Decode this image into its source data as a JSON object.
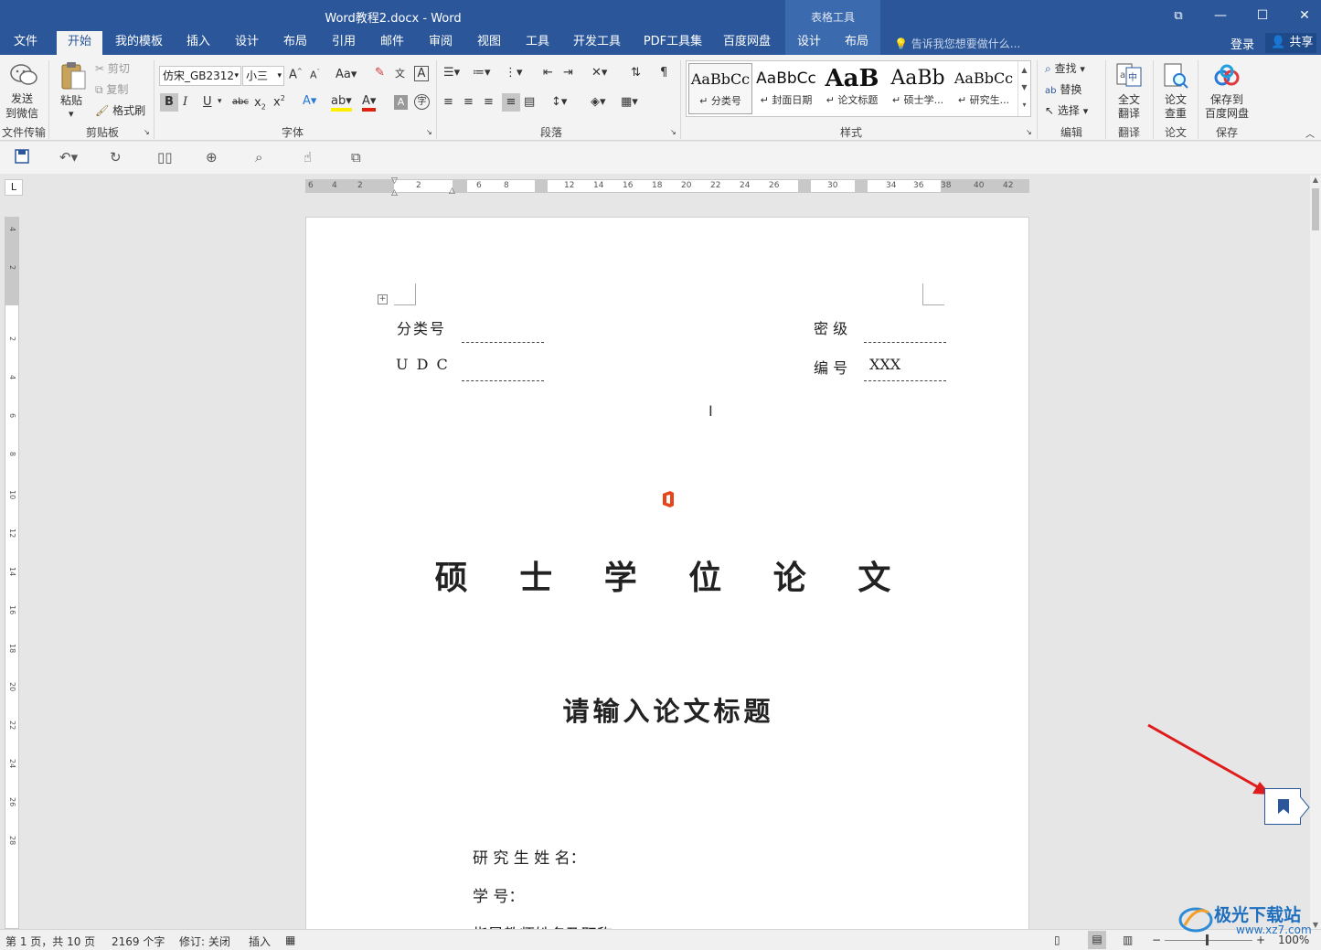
{
  "window": {
    "title": "Word教程2.docx - Word",
    "context_title": "表格工具",
    "minimize": "—",
    "maximize": "☐",
    "close": "✕",
    "restore_icon": "⧉"
  },
  "tabs": [
    {
      "label": "文件"
    },
    {
      "label": "开始"
    },
    {
      "label": "我的模板"
    },
    {
      "label": "插入"
    },
    {
      "label": "设计"
    },
    {
      "label": "布局"
    },
    {
      "label": "引用"
    },
    {
      "label": "邮件"
    },
    {
      "label": "审阅"
    },
    {
      "label": "视图"
    },
    {
      "label": "工具"
    },
    {
      "label": "开发工具"
    },
    {
      "label": "PDF工具集"
    },
    {
      "label": "百度网盘"
    },
    {
      "label": "设计"
    },
    {
      "label": "布局"
    }
  ],
  "tell_me": "告诉我您想要做什么...",
  "login": "登录",
  "share": "共享",
  "ribbon": {
    "wechat": {
      "line1": "发送",
      "line2": "到微信",
      "group": "文件传输"
    },
    "clipboard": {
      "paste": "粘贴",
      "cut": "剪切",
      "copy": "复制",
      "format_painter": "格式刷",
      "group": "剪贴板"
    },
    "font": {
      "name": "仿宋_GB2312",
      "size": "小三",
      "group": "字体"
    },
    "paragraph": {
      "group": "段落"
    },
    "styles": {
      "group": "样式",
      "items": [
        {
          "sample": "AaBbCc",
          "name": "↵ 分类号"
        },
        {
          "sample": "AaBbCc",
          "name": "↵ 封面日期"
        },
        {
          "sample": "AaB",
          "name": "↵ 论文标题"
        },
        {
          "sample": "AaBb",
          "name": "↵ 硕士学..."
        },
        {
          "sample": "AaBbCc",
          "name": "↵ 研究生..."
        }
      ]
    },
    "editing": {
      "find": "查找",
      "replace": "替换",
      "select": "选择",
      "group": "编辑"
    },
    "translate": {
      "line1": "全文",
      "line2": "翻译",
      "group": "翻译"
    },
    "thesis": {
      "line1": "论文",
      "line2": "查重",
      "group": "论文"
    },
    "save": {
      "line1": "保存到",
      "line2": "百度网盘",
      "group": "保存"
    }
  },
  "ruler": {
    "corner": "L",
    "h_ticks": [
      "6",
      "4",
      "2",
      "2",
      "6",
      "8",
      "12",
      "14",
      "16",
      "18",
      "20",
      "22",
      "24",
      "26",
      "30",
      "34",
      "36",
      "38",
      "40",
      "42"
    ],
    "v_ticks": [
      "4",
      "2",
      "2",
      "4",
      "6",
      "8",
      "10",
      "12",
      "14",
      "16",
      "18",
      "20",
      "22",
      "24",
      "26",
      "28"
    ]
  },
  "document": {
    "fenleihao": "分类号",
    "miji": "密    级",
    "udc": "U D C",
    "bianhao": "编    号",
    "bianhao_value": "XXX",
    "degree_title": "硕 士 学 位 论 文",
    "thesis_title": "请输入论文标题",
    "student_name": "研 究 生 姓 名：",
    "student_id": "学               号：",
    "advisor": "指导教师姓名及职称："
  },
  "status": {
    "page": "第 1 页，共 10 页",
    "words": "2169 个字",
    "track": "修订: 关闭",
    "insert": "插入",
    "zoom": "100%"
  },
  "watermark": {
    "brand": "极光下载站",
    "url": "www.xz7.com"
  },
  "colors": {
    "accent": "#2b579a",
    "arrow": "#e01b1b"
  }
}
